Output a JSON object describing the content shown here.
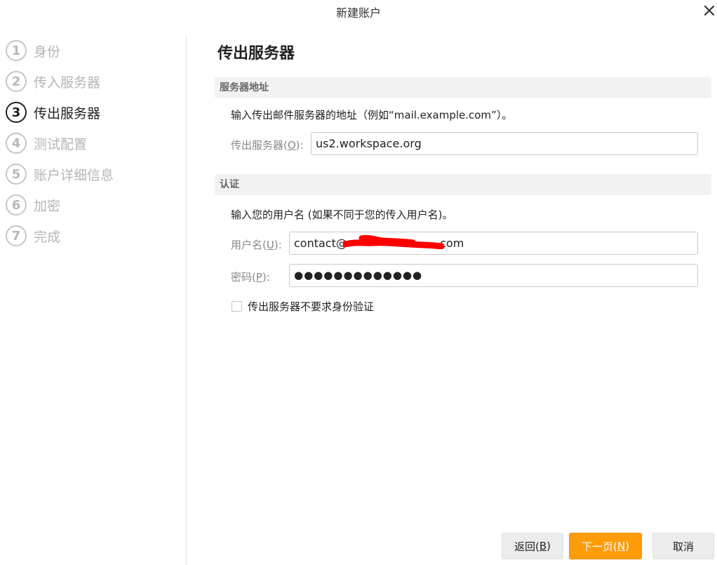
{
  "window": {
    "title": "新建账户",
    "close_icon": "close-icon"
  },
  "colors": {
    "accent": "#fe9c0a",
    "section_bg": "#f2f2f2",
    "inactive_text": "#b5b5b5",
    "redaction": "#ff0000"
  },
  "sidebar": {
    "steps": [
      {
        "number": "1",
        "label": "身份",
        "active": false
      },
      {
        "number": "2",
        "label": "传入服务器",
        "active": false
      },
      {
        "number": "3",
        "label": "传出服务器",
        "active": true
      },
      {
        "number": "4",
        "label": "测试配置",
        "active": false
      },
      {
        "number": "5",
        "label": "账户详细信息",
        "active": false
      },
      {
        "number": "6",
        "label": "加密",
        "active": false
      },
      {
        "number": "7",
        "label": "完成",
        "active": false
      }
    ]
  },
  "main": {
    "title": "传出服务器",
    "server_section": {
      "header": "服务器地址",
      "description": "输入传出邮件服务器的地址（例如“mail.example.com”）。",
      "server_label": "传出服务器(",
      "server_accesskey": "O",
      "server_label_end": "):",
      "server_value": "us2.workspace.org"
    },
    "auth_section": {
      "header": "认证",
      "description": "输入您的用户名 (如果不同于您的传入用户名)。",
      "username_label": "用户名(",
      "username_accesskey": "U",
      "username_label_end": "):",
      "username_value": "contact@                         .com",
      "password_label": "密码(",
      "password_accesskey": "P",
      "password_label_end": "):",
      "password_value": "●●●●●●●●●●●●●",
      "no_auth_checkbox_label": "传出服务器不要求身份验证",
      "no_auth_checked": false
    }
  },
  "footer": {
    "back": {
      "label": "返回(",
      "accesskey": "B",
      "end": ")"
    },
    "next": {
      "label": "下一页(",
      "accesskey": "N",
      "end": ")"
    },
    "cancel": {
      "label": "取消"
    }
  }
}
